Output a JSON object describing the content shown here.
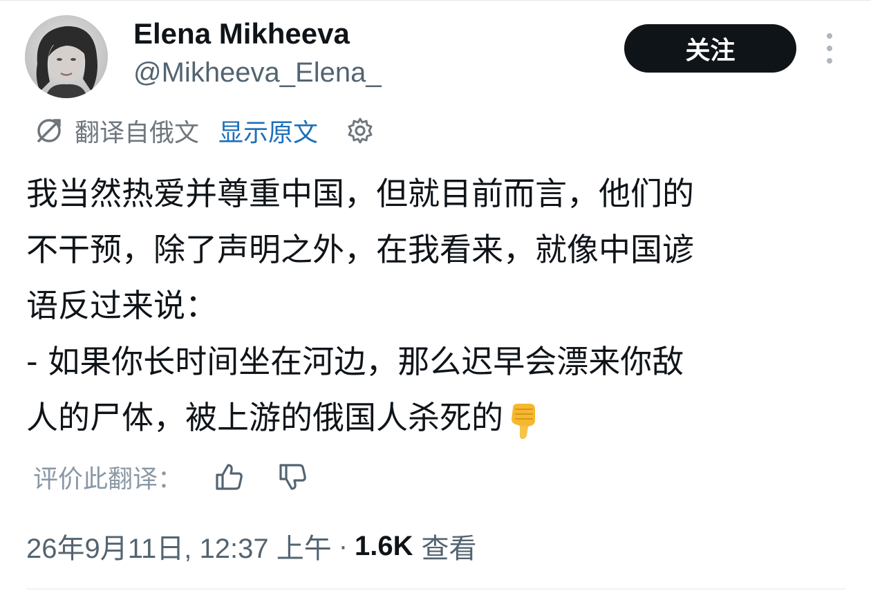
{
  "post": {
    "author_name": "Elena Mikheeva",
    "author_handle": "@Mikheeva_Elena_",
    "follow_label": "关注",
    "translation": {
      "translated_from": "翻译自俄文",
      "show_original": "显示原文"
    },
    "body_lines": [
      "我当然热爱并尊重中国，但就目前而言，他们的",
      "不干预，除了声明之外，在我看来，就像中国谚",
      "语反过来说：",
      "- 如果你长时间坐在河边，那么迟早会漂来你敌",
      "人的尸体，被上游的俄国人杀死的"
    ],
    "body_emoji": "pointing-down-hand-emoji",
    "rate_translation_label": "评价此翻译：",
    "timestamp": "26年9月11日, 12:37 上午",
    "separator": "·",
    "views_count": "1.6K",
    "views_label": "查看"
  },
  "icons": {
    "translate": "translate-icon",
    "settings": "gear-icon",
    "thumb_up": "thumbs-up-icon",
    "thumb_down": "thumbs-down-icon",
    "more": "more-vertical-icon"
  },
  "colors": {
    "text_primary": "#0f1419",
    "text_secondary": "#536471",
    "link": "#1d6fb8",
    "button_bg": "#0f1419",
    "button_text": "#ffffff"
  }
}
